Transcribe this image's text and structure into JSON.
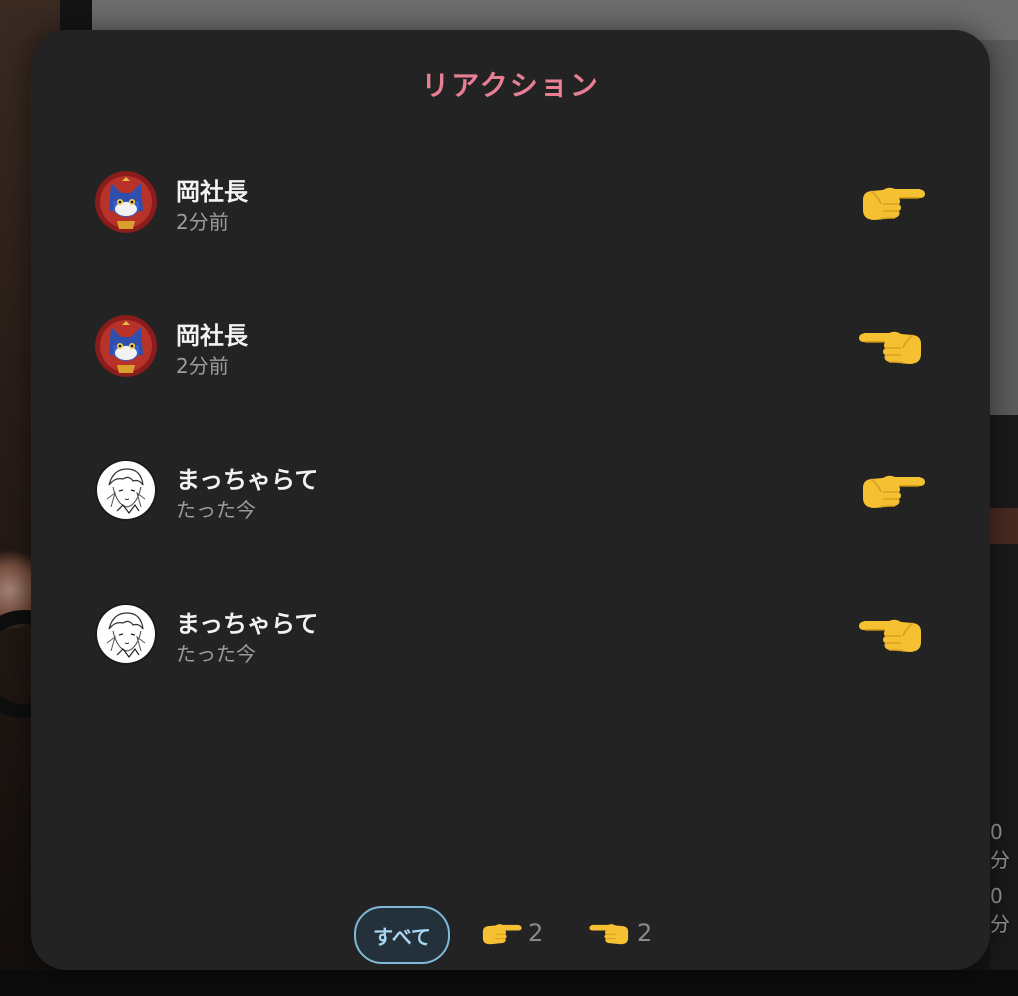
{
  "modal": {
    "title": "リアクション"
  },
  "reactions": [
    {
      "name": "岡社長",
      "time": "2分前",
      "avatar": "cat-avatar",
      "emoji": "pointing-right-icon"
    },
    {
      "name": "岡社長",
      "time": "2分前",
      "avatar": "cat-avatar",
      "emoji": "pointing-left-icon"
    },
    {
      "name": "まっちゃらて",
      "time": "たった今",
      "avatar": "sketch-avatar",
      "emoji": "pointing-right-icon"
    },
    {
      "name": "まっちゃらて",
      "time": "たった今",
      "avatar": "sketch-avatar",
      "emoji": "pointing-left-icon"
    }
  ],
  "tabs": {
    "all_label": "すべて",
    "right_count": "2",
    "left_count": "2"
  },
  "background": {
    "right_text_1": "0分",
    "right_text_2": "0分"
  },
  "colors": {
    "title": "#e87f95",
    "tab_active_border": "#7fb8d8",
    "modal_bg": "#232323"
  }
}
